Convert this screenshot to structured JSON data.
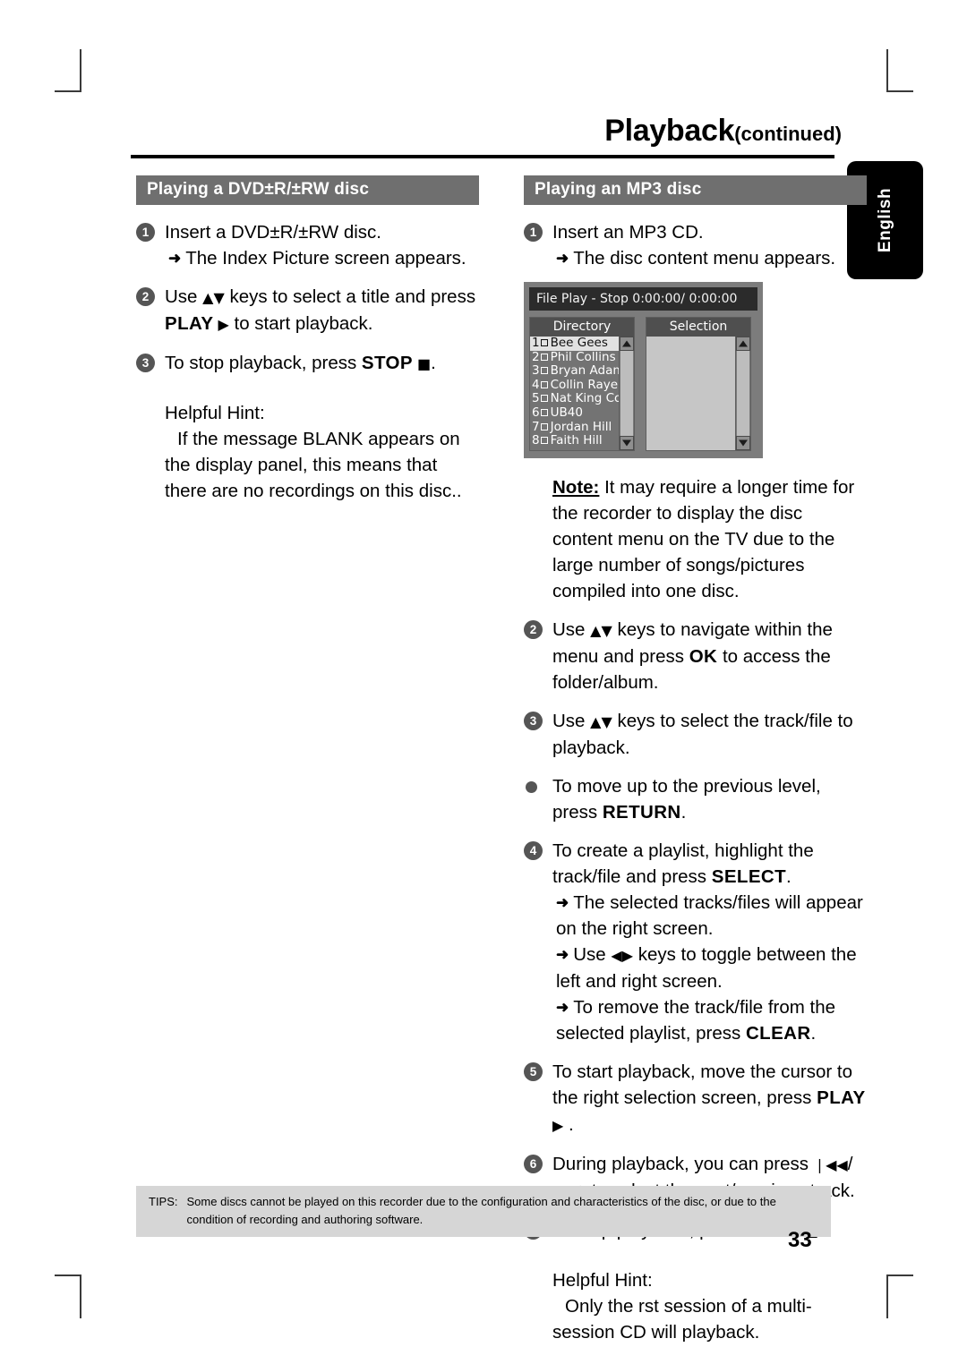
{
  "header": {
    "title_main": "Playback",
    "title_sub": "(continued)"
  },
  "language_tab": {
    "label": "English"
  },
  "left_column": {
    "section_title": "Playing a DVD±R/±RW disc",
    "steps": [
      {
        "num": "1",
        "text": "Insert a DVD±R/±RW disc.",
        "subs": [
          {
            "arrow": "➜",
            "text": "The Index Picture screen appears."
          }
        ]
      },
      {
        "num": "2",
        "text_parts": [
          {
            "t": "Use "
          },
          {
            "t": "▲▼",
            "glyph": true
          },
          {
            "t": " keys to select a title and press "
          },
          {
            "t": "PLAY",
            "bold": true
          },
          {
            "t": " ▶",
            "glyph": true
          },
          {
            "t": " to start playback."
          }
        ]
      },
      {
        "num": "3",
        "text_parts": [
          {
            "t": "To stop playback, press "
          },
          {
            "t": "STOP",
            "bold": true
          },
          {
            "t": " ■",
            "glyph": true
          },
          {
            "t": "."
          }
        ]
      }
    ],
    "hint": {
      "heading": "Helpful Hint:",
      "body": "If the message  BLANK  appears on the display panel, this means that there are no recordings on this disc.."
    }
  },
  "right_column": {
    "section_title": "Playing an MP3 disc",
    "step1": {
      "num": "1",
      "text": "Insert an MP3 CD.",
      "sub": {
        "arrow": "➜",
        "text": "The disc content menu appears."
      }
    },
    "osd": {
      "titlebar": "File Play - Stop 0:00:00/ 0:00:00",
      "directory": {
        "header": "Directory",
        "items": [
          {
            "index": "1",
            "name": "Bee Gees",
            "selected": true
          },
          {
            "index": "2",
            "name": "Phil Collins",
            "selected": false
          },
          {
            "index": "3",
            "name": "Bryan Adam",
            "selected": false
          },
          {
            "index": "4",
            "name": "Collin Raye",
            "selected": false
          },
          {
            "index": "5",
            "name": "Nat King Co",
            "selected": false
          },
          {
            "index": "6",
            "name": "UB40",
            "selected": false
          },
          {
            "index": "7",
            "name": "Jordan Hill",
            "selected": false
          },
          {
            "index": "8",
            "name": "Faith Hill",
            "selected": false
          }
        ]
      },
      "selection": {
        "header": "Selection",
        "items": []
      }
    },
    "note": {
      "label": "Note:",
      "text": " It may require a longer time for the recorder to display the disc content menu on the TV due to the large number of songs/pictures compiled into one disc."
    },
    "steps": [
      {
        "num": "2",
        "text_parts": [
          {
            "t": "Use "
          },
          {
            "t": "▲▼",
            "glyph": true
          },
          {
            "t": " keys to navigate within the menu and press "
          },
          {
            "t": "OK",
            "bold": true
          },
          {
            "t": " to access the folder/album."
          }
        ]
      },
      {
        "num": "3",
        "text_parts": [
          {
            "t": "Use "
          },
          {
            "t": "▲▼",
            "glyph": true
          },
          {
            "t": " keys to select the track/file to playback."
          }
        ]
      },
      {
        "dot": true,
        "text_parts": [
          {
            "t": "To move up to the previous level, press "
          },
          {
            "t": "RETURN",
            "bold": true
          },
          {
            "t": "."
          }
        ]
      },
      {
        "num": "4",
        "text_parts": [
          {
            "t": "To create a playlist, highlight the track/file and press "
          },
          {
            "t": "SELECT",
            "bold": true
          },
          {
            "t": "."
          }
        ],
        "subs": [
          {
            "arrow": "➜",
            "text": "The selected tracks/files will appear on the right screen."
          },
          {
            "arrow": "➜",
            "parts": [
              {
                "t": "Use "
              },
              {
                "t": "◀▶",
                "glyph": true
              },
              {
                "t": " keys to toggle between the left and right screen."
              }
            ]
          },
          {
            "arrow": "➜",
            "parts": [
              {
                "t": "To remove the track/file from the selected playlist, press "
              },
              {
                "t": "CLEAR",
                "bold": true
              },
              {
                "t": "."
              }
            ]
          }
        ]
      },
      {
        "num": "5",
        "text_parts": [
          {
            "t": "To start playback, move the cursor to the right selection screen, press "
          },
          {
            "t": "PLAY",
            "bold": true
          },
          {
            "t": " ▶",
            "glyph": true
          },
          {
            "t": " ."
          }
        ]
      },
      {
        "num": "6",
        "text_parts": [
          {
            "t": "During playback, you can press "
          },
          {
            "t": "❘◀◀",
            "glyph": true
          },
          {
            "t": "/ "
          },
          {
            "t": "▶▶❘",
            "glyph": true
          },
          {
            "t": " to select the next/previous track."
          }
        ]
      },
      {
        "num": "7",
        "text_parts": [
          {
            "t": "To stop playback, press "
          },
          {
            "t": "STOP",
            "bold": true
          },
          {
            "t": " ■",
            "glyph": true
          },
          {
            "t": "."
          }
        ]
      }
    ],
    "hint": {
      "heading": "Helpful Hint:",
      "body": "Only the  rst session of a multi-session CD will playback."
    }
  },
  "footer": {
    "tips_label": "TIPS:",
    "tips_text": "Some discs cannot be played on this recorder due to the configuration and characteristics of the disc, or due to the condition of recording and authoring software.",
    "page_number": "33"
  },
  "colors": {
    "section_bar": "#6f6f6f",
    "bullet": "#555555",
    "tips_bg": "#d6d6d6",
    "osd_bg": "#7c7c7c",
    "osd_titlebar": "#2b2b2b"
  }
}
